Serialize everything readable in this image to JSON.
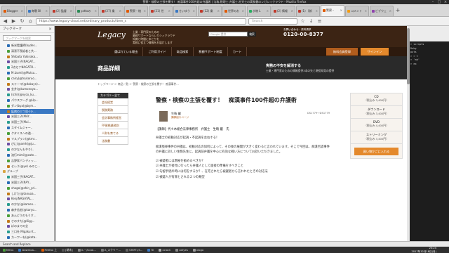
{
  "window": {
    "title": "警察・検察の主張を覆す！ 痴漢事件100件超の弁護術 | 法務,税理士,弁護士,社労士の実務書のレガシィクラウド - Mozilla Firefox"
  },
  "tabs": [
    {
      "label": "Blogger"
    },
    {
      "label": "毎朝 Bl"
    },
    {
      "label": "(2) 監督"
    },
    {
      "label": "yattoの"
    },
    {
      "label": "(27) 業"
    },
    {
      "label": "警察・検"
    },
    {
      "label": "(21) 世"
    },
    {
      "label": "せいゆう"
    },
    {
      "label": "(12) 業"
    },
    {
      "label": "世界のお"
    },
    {
      "label": "水物 L"
    },
    {
      "label": "(2) 情報"
    },
    {
      "label": "(1) 【新"
    },
    {
      "label": "警察・"
    },
    {
      "label": "コメント"
    },
    {
      "label": "ビデウェ"
    }
  ],
  "nav": {
    "url": "https://www.legacy-cloud.net/ordinary_products/item_s",
    "search_placeholder": "Search"
  },
  "sidebar": {
    "title": "ブックマーク",
    "search_placeholder": "ブックマークを検索",
    "items": [
      "新米看護師(bydes...",
      "清潔不潔認者と共...",
      "Shibata Yukinaka...",
      "米国三子(NAGAT...",
      "2点セナNAGATO...",
      "M.Izumi(@Mutsu...",
      "cairy(@tsukoruo...",
      "ステーマ(@dakayn)...",
      "金井(@kumonoyo...",
      "(ichi)(@nyco_ku...",
      "パウスワーグ @Up...",
      "ダン(bya(@bym...",
      "疫病の三つ見-(ラ...",
      "米国三子(MAY...",
      "米国三子(Mai...",
      "スタイムジャー..",
      "クタミスへの道...",
      "マスプラン(@kmr...",
      "びに(@amh(@ju...",
      "のかなんもやり(..",
      "流行mimi(@cate...",
      "吉野家パンディッ...",
      "せぃう(@ye) みのこ...",
      "グループ",
      "米国三子(NAGAT...",
      "米国三子(NAY...",
      "shogo(@shin_yd...",
      "しけた(@tanuoa...",
      "KenjiNAGATAL...",
      "のかな(@kamen...",
      "森井信宏(@karyo...",
      "あんどうのもうす...",
      "さのすた(@Kigy...",
      "ぼのまでの全",
      "三口社 Migaku K...",
      "カーワーを(@kata..",
      "あんざー(@Makol..."
    ]
  },
  "site": {
    "logo": "Legacy",
    "blurb": [
      "士業・専門家のための",
      "業務サポートならレガシィクラウド",
      "知識と時間にゆとりを",
      "実務に役立つ情報をお届けします"
    ],
    "search_placeholder": "Google 提供",
    "search_button": "検索",
    "phone_label": "お問い合わせ・資料請求",
    "phone_number": "0120-00-8377",
    "nav": [
      "選ばれている理由",
      "ご利用ガイド",
      "商品検索",
      "税額サポート制度",
      "カート"
    ],
    "btn_member": "無料会員登録",
    "btn_signin": "サインイン",
    "hero_title": "商品詳細",
    "hero_sub1": "実務の不安を解消する",
    "hero_sub2": "士業・専門家のための情報提供3本の矢と現役知見の提供",
    "breadcrumb": "トップページ ＞ 商品一覧 ＞ 警察・検察の主張を覆す！ 痴漢事件..."
  },
  "categories": {
    "head": "カテゴリー全て",
    "items": [
      "会社経営",
      "税務実務",
      "会計事務所経営",
      "FP資格業務別",
      "人財を育てる",
      "法務書"
    ]
  },
  "article": {
    "title": "警察・検察の主張を覆す！　痴漢事件100件超の弁護術",
    "author": "生駒 巌",
    "author_link": "講師紹介ページ",
    "code": "DS1779～DS1779",
    "meta": "【講師】代々木総合法律事務所　弁護士　生駒 巌　氏",
    "p1": "弁護士の初動対応が起訴・不起訴を左右する！",
    "p2": "痴漢冤罪事件の弁護は、初動対応の如何によって、その後の展開が大きく変わると言われています。そこで今回は、痴漢否認事件の弁護に詳しい生駒先生に、起訴前弁護を中心に有効な戦い方についてお話いただきました。",
    "list": [
      "被疑者には黙秘を勧めるべきか？",
      "弁護士が接見に行ったら弁護人として面接の準備をすべきこと",
      "勾留手続の時には何をするか？、在宅されたら被疑者から言われたときの対応法",
      "被疑人が有罪とされる２つの類型"
    ]
  },
  "products": {
    "items": [
      {
        "name": "CD",
        "price": "（税込み 3,400円）"
      },
      {
        "name": "ダウンロード",
        "price": "（税込み 3,400円）"
      },
      {
        "name": "DVD",
        "price": "（税込み 4,400円）"
      },
      {
        "name": "ストリーミング",
        "price": "（税込み 3,400円）"
      }
    ],
    "buy": "買い物かごに入れる"
  },
  "terminal": {
    "lines": [
      "> scripts",
      "Ruby",
      "",
      "puts",
      "> > t",
      "",
      "",
      "",
      "",
      "",
      "",
      "",
      "",
      "",
      "",
      "> 'ab'",
      "",
      "",
      "",
      "",
      "",
      "",
      "",
      "",
      "",
      "",
      "",
      "> ex"
    ],
    "label": "Ruby"
  },
  "status": "Search and Replace",
  "taskbar": [
    "Menu",
    "Downloa...",
    "Firefox 上",
    "[端末]",
    "ls ~/local...",
    "A_スクリー...",
    "SHIFT-JS...",
    "Te",
    "xclock",
    "oxtyes",
    "xlogo"
  ],
  "clock": {
    "time": "20:24",
    "date": "2017年12月18日(月)"
  },
  "colors": {
    "brand_dark": "#3c2414",
    "accent": "#e4892c",
    "accent_dark": "#b15d1d",
    "selection": "#3a78c3"
  }
}
